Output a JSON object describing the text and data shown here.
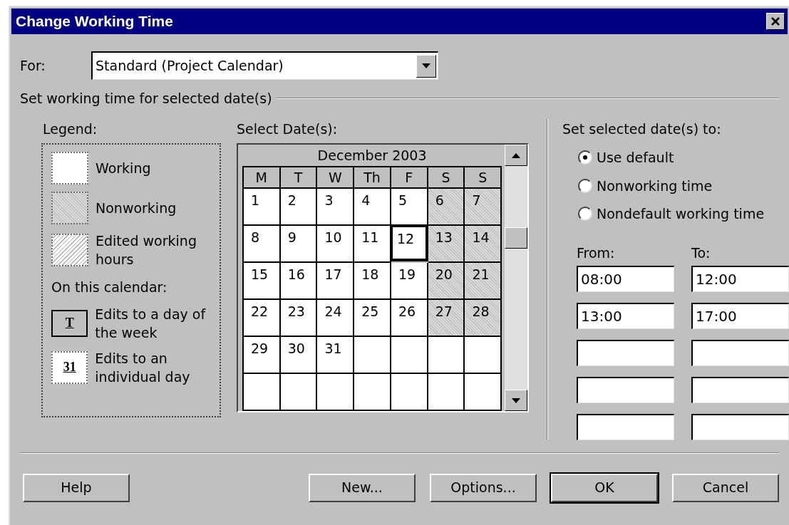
{
  "window": {
    "title": "Change Working Time"
  },
  "for_field": {
    "label": "For:",
    "value": "Standard (Project Calendar)"
  },
  "group_title": "Set working time for selected date(s)",
  "legend": {
    "title": "Legend:",
    "items": [
      {
        "kind": "working",
        "label": "Working"
      },
      {
        "kind": "nonworking",
        "label": "Nonworking"
      },
      {
        "kind": "edited",
        "label": "Edited working hours"
      }
    ],
    "subtitle": "On this calendar:",
    "calendar_items": [
      {
        "kind": "weekday",
        "glyph": "T",
        "label": "Edits to a day of the week"
      },
      {
        "kind": "day",
        "glyph": "31",
        "label": "Edits to an individual day"
      }
    ]
  },
  "calendar": {
    "label": "Select Date(s):",
    "month": "December 2003",
    "weekdays": [
      "M",
      "T",
      "W",
      "Th",
      "F",
      "S",
      "S"
    ],
    "weeks": [
      [
        {
          "day": "1",
          "kind": "working",
          "selected": false
        },
        {
          "day": "2",
          "kind": "working",
          "selected": false
        },
        {
          "day": "3",
          "kind": "working",
          "selected": false
        },
        {
          "day": "4",
          "kind": "working",
          "selected": false
        },
        {
          "day": "5",
          "kind": "working",
          "selected": false
        },
        {
          "day": "6",
          "kind": "nonworking",
          "selected": false
        },
        {
          "day": "7",
          "kind": "nonworking",
          "selected": false
        }
      ],
      [
        {
          "day": "8",
          "kind": "working",
          "selected": false
        },
        {
          "day": "9",
          "kind": "working",
          "selected": false
        },
        {
          "day": "10",
          "kind": "working",
          "selected": false
        },
        {
          "day": "11",
          "kind": "working",
          "selected": false
        },
        {
          "day": "12",
          "kind": "working",
          "selected": true
        },
        {
          "day": "13",
          "kind": "nonworking",
          "selected": false
        },
        {
          "day": "14",
          "kind": "nonworking",
          "selected": false
        }
      ],
      [
        {
          "day": "15",
          "kind": "working",
          "selected": false
        },
        {
          "day": "16",
          "kind": "working",
          "selected": false
        },
        {
          "day": "17",
          "kind": "working",
          "selected": false
        },
        {
          "day": "18",
          "kind": "working",
          "selected": false
        },
        {
          "day": "19",
          "kind": "working",
          "selected": false
        },
        {
          "day": "20",
          "kind": "nonworking",
          "selected": false
        },
        {
          "day": "21",
          "kind": "nonworking",
          "selected": false
        }
      ],
      [
        {
          "day": "22",
          "kind": "working",
          "selected": false
        },
        {
          "day": "23",
          "kind": "working",
          "selected": false
        },
        {
          "day": "24",
          "kind": "working",
          "selected": false
        },
        {
          "day": "25",
          "kind": "working",
          "selected": false
        },
        {
          "day": "26",
          "kind": "working",
          "selected": false
        },
        {
          "day": "27",
          "kind": "nonworking",
          "selected": false
        },
        {
          "day": "28",
          "kind": "nonworking",
          "selected": false
        }
      ],
      [
        {
          "day": "29",
          "kind": "working",
          "selected": false
        },
        {
          "day": "30",
          "kind": "working",
          "selected": false
        },
        {
          "day": "31",
          "kind": "working",
          "selected": false
        },
        {
          "kind": "empty",
          "selected": false
        },
        {
          "kind": "empty",
          "selected": false
        },
        {
          "kind": "empty",
          "selected": false
        },
        {
          "kind": "empty",
          "selected": false
        }
      ],
      [
        {
          "kind": "empty",
          "selected": false
        },
        {
          "kind": "empty",
          "selected": false
        },
        {
          "kind": "empty",
          "selected": false
        },
        {
          "kind": "empty",
          "selected": false
        },
        {
          "kind": "empty",
          "selected": false
        },
        {
          "kind": "empty",
          "selected": false
        },
        {
          "kind": "empty",
          "selected": false
        }
      ]
    ]
  },
  "set_to": {
    "title": "Set selected date(s) to:",
    "options": [
      {
        "label": "Use default",
        "selected": true
      },
      {
        "label": "Nonworking time",
        "selected": false
      },
      {
        "label": "Nondefault working time",
        "selected": false
      }
    ],
    "from_label": "From:",
    "to_label": "To:",
    "rows": [
      {
        "from": "08:00",
        "to": "12:00"
      },
      {
        "from": "13:00",
        "to": "17:00"
      },
      {},
      {},
      {}
    ]
  },
  "buttons": [
    {
      "kind": "left",
      "label": "Help",
      "default": false
    },
    {
      "kind": "right",
      "label": "New...",
      "default": false
    },
    {
      "kind": "right",
      "label": "Options...",
      "default": false
    },
    {
      "kind": "right",
      "label": "OK",
      "default": true
    },
    {
      "kind": "right",
      "label": "Cancel",
      "default": false
    }
  ]
}
